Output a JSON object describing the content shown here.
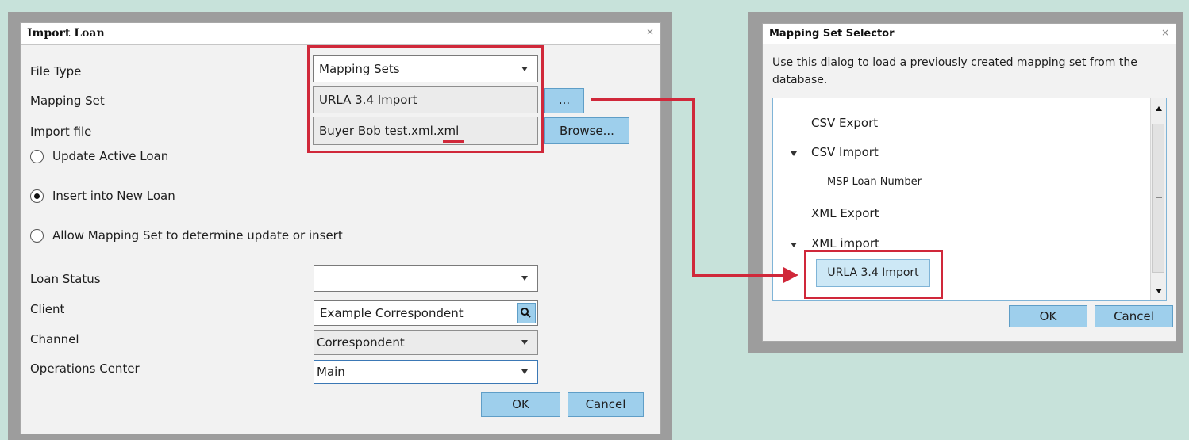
{
  "import_dialog": {
    "title": "Import Loan",
    "close_icon": "×",
    "labels": {
      "file_type": "File Type",
      "mapping_set": "Mapping Set",
      "import_file": "Import file",
      "loan_status": "Loan Status",
      "client": "Client",
      "channel": "Channel",
      "operations_center": "Operations Center"
    },
    "file_type_value": "Mapping Sets",
    "mapping_set_value": "URLA 3.4 Import",
    "import_file_value": "Buyer Bob test.xml.xml",
    "ellipsis_button": "...",
    "browse_button": "Browse...",
    "radio_options": [
      {
        "label": "Update Active Loan",
        "selected": false
      },
      {
        "label": "Insert into New Loan",
        "selected": true
      },
      {
        "label": "Allow Mapping Set to determine update or insert",
        "selected": false
      }
    ],
    "loan_status_value": "",
    "client_value": "Example Correspondent",
    "channel_value": "Correspondent",
    "operations_center_value": "Main",
    "ok_button": "OK",
    "cancel_button": "Cancel"
  },
  "selector_dialog": {
    "title": "Mapping Set Selector",
    "close_icon": "×",
    "description_line1": "Use this dialog to load a previously created mapping set from the",
    "description_line2": "database.",
    "tree": {
      "csv_export": "CSV Export",
      "csv_import": "CSV Import",
      "msp_loan_number": "MSP Loan Number",
      "xml_export": "XML Export",
      "xml_import": "XML import",
      "urla_import": "URLA 3.4 Import"
    },
    "ok_button": "OK",
    "cancel_button": "Cancel"
  },
  "colors": {
    "annotation_red": "#d0283a",
    "button_blue": "#9ecfec",
    "background": "#c7e2da"
  }
}
